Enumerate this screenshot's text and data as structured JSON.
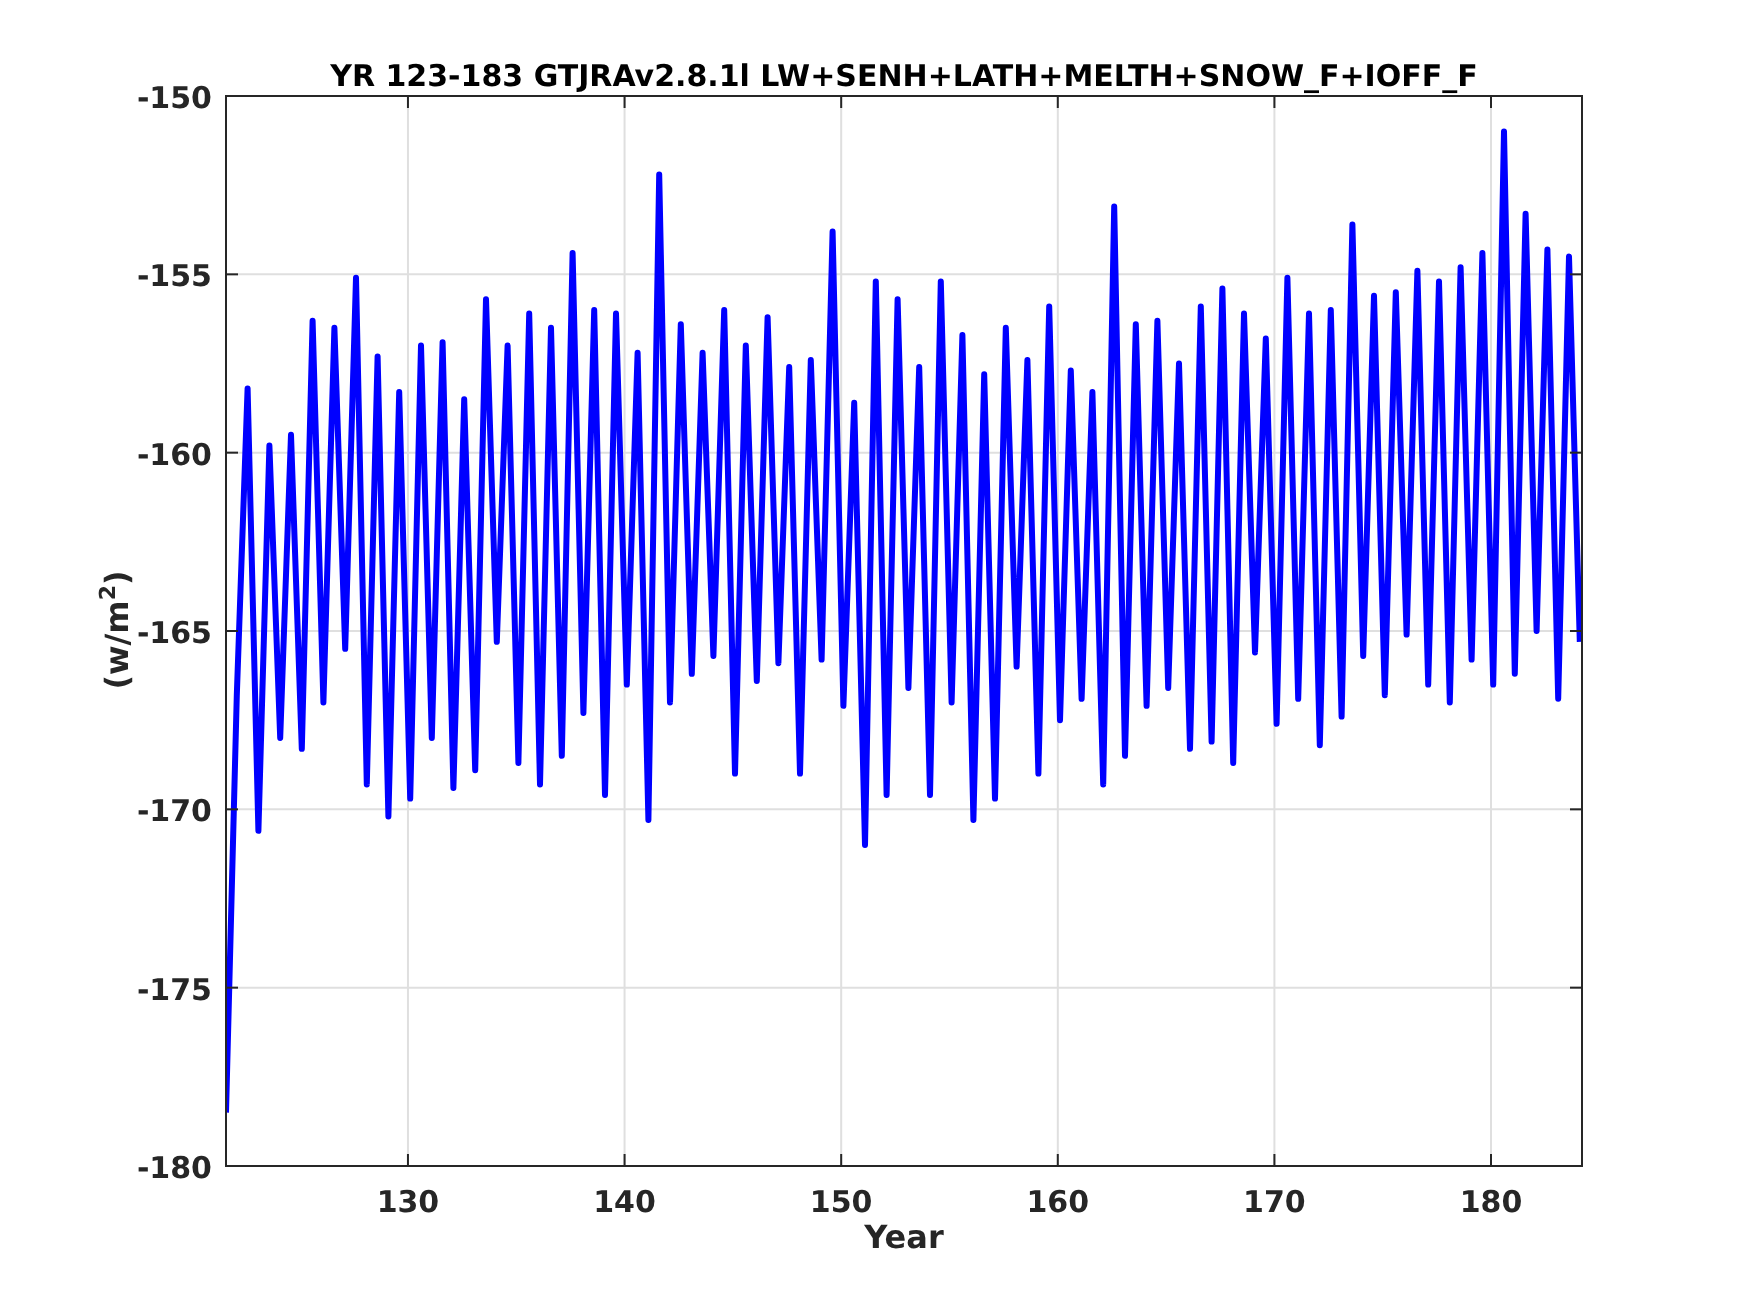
{
  "figure": {
    "chart_data": {
      "type": "line",
      "title": "YR 123-183 GTJRAv2.8.1l LW+SENH+LATH+MELTH+SNOW_F+IOFF_F",
      "xlabel": "Year",
      "ylabel": "(w/m$^{2}$)",
      "xlim": [
        121.6,
        184.2
      ],
      "ylim": [
        -180,
        -150
      ],
      "xticks": [
        130,
        140,
        150,
        160,
        170,
        180
      ],
      "yticks": [
        -180,
        -175,
        -170,
        -165,
        -160,
        -155,
        -150
      ],
      "grid": true,
      "x": [
        121.6,
        122.1,
        122.6,
        123.1,
        123.6,
        124.1,
        124.6,
        125.1,
        125.6,
        126.1,
        126.6,
        127.1,
        127.6,
        128.1,
        128.6,
        129.1,
        129.6,
        130.1,
        130.6,
        131.1,
        131.6,
        132.1,
        132.6,
        133.1,
        133.6,
        134.1,
        134.6,
        135.1,
        135.6,
        136.1,
        136.6,
        137.1,
        137.6,
        138.1,
        138.6,
        139.1,
        139.6,
        140.1,
        140.6,
        141.1,
        141.6,
        142.1,
        142.6,
        143.1,
        143.6,
        144.1,
        144.6,
        145.1,
        145.6,
        146.1,
        146.6,
        147.1,
        147.6,
        148.1,
        148.6,
        149.1,
        149.6,
        150.1,
        150.6,
        151.1,
        151.6,
        152.1,
        152.6,
        153.1,
        153.6,
        154.1,
        154.6,
        155.1,
        155.6,
        156.1,
        156.6,
        157.1,
        157.6,
        158.1,
        158.6,
        159.1,
        159.6,
        160.1,
        160.6,
        161.1,
        161.6,
        162.1,
        162.6,
        163.1,
        163.6,
        164.1,
        164.6,
        165.1,
        165.6,
        166.1,
        166.6,
        167.1,
        167.6,
        168.1,
        168.6,
        169.1,
        169.6,
        170.1,
        170.6,
        171.1,
        171.6,
        172.1,
        172.6,
        173.1,
        173.6,
        174.1,
        174.6,
        175.1,
        175.6,
        176.1,
        176.6,
        177.1,
        177.6,
        178.1,
        178.6,
        179.1,
        179.6,
        180.1,
        180.6,
        181.1,
        181.6,
        182.1,
        182.6,
        183.1,
        183.6,
        184.1
      ],
      "series": [
        {
          "color": "#0000ff",
          "values": [
            -178.5,
            -166.8,
            -158.2,
            -170.6,
            -159.8,
            -168.0,
            -159.5,
            -168.3,
            -156.3,
            -167.0,
            -156.5,
            -165.5,
            -155.1,
            -169.3,
            -157.3,
            -170.2,
            -158.3,
            -169.7,
            -157.0,
            -168.0,
            -156.9,
            -169.4,
            -158.5,
            -168.9,
            -155.7,
            -165.3,
            -157.0,
            -168.7,
            -156.1,
            -169.3,
            -156.5,
            -168.5,
            -154.4,
            -167.3,
            -156.0,
            -169.6,
            -156.1,
            -166.5,
            -157.2,
            -170.3,
            -152.2,
            -167.0,
            -156.4,
            -166.2,
            -157.2,
            -165.7,
            -156.0,
            -169.0,
            -157.0,
            -166.4,
            -156.2,
            -165.9,
            -157.6,
            -169.0,
            -157.4,
            -165.8,
            -153.8,
            -167.1,
            -158.6,
            -171.0,
            -155.2,
            -169.6,
            -155.7,
            -166.6,
            -157.6,
            -169.6,
            -155.2,
            -167.0,
            -156.7,
            -170.3,
            -157.8,
            -169.7,
            -156.5,
            -166.0,
            -157.4,
            -169.0,
            -155.9,
            -167.5,
            -157.7,
            -166.9,
            -158.3,
            -169.3,
            -153.1,
            -168.5,
            -156.4,
            -167.1,
            -156.3,
            -166.6,
            -157.5,
            -168.3,
            -155.9,
            -168.1,
            -155.4,
            -168.7,
            -156.1,
            -165.6,
            -156.8,
            -167.6,
            -155.1,
            -166.9,
            -156.1,
            -168.2,
            -156.0,
            -167.4,
            -153.6,
            -165.7,
            -155.6,
            -166.8,
            -155.5,
            -165.1,
            -154.9,
            -166.5,
            -155.2,
            -167.0,
            -154.8,
            -165.8,
            -154.4,
            -166.5,
            -151.0,
            -166.2,
            -153.3,
            -165.0,
            -154.3,
            -166.9,
            -154.5,
            -165.3
          ]
        }
      ]
    }
  }
}
